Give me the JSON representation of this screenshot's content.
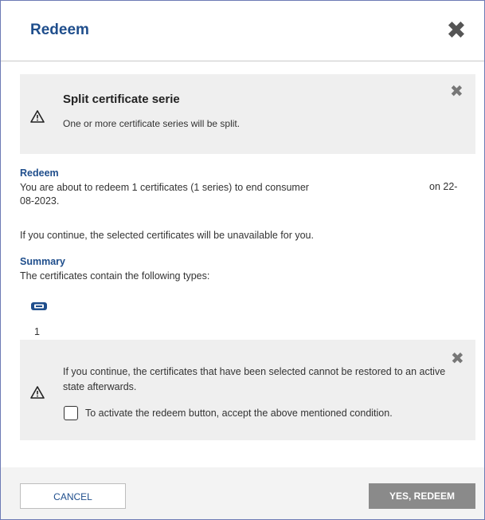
{
  "dialog": {
    "title": "Redeem"
  },
  "split_notice": {
    "title": "Split certificate serie",
    "text": "One or more certificate series will be split."
  },
  "redeem_section": {
    "heading": "Redeem",
    "line1": "You are about to redeem 1 certificates (1 series) to end consumer",
    "date_part1": "on 22-",
    "date_part2": "08-2023.",
    "unavailable_text": "If you continue, the selected certificates will be unavailable for you."
  },
  "summary_section": {
    "heading": "Summary",
    "text": "The certificates contain the following types:",
    "type_icon": "certificate-type-icon",
    "type_count": "1"
  },
  "warning_notice": {
    "text": "If you continue, the certificates that have been selected cannot be restored to an active state afterwards.",
    "checkbox_label": "To activate the redeem button, accept the above mentioned condition.",
    "checkbox_checked": false
  },
  "footer": {
    "cancel_label": "CANCEL",
    "redeem_label": "YES, REDEEM"
  },
  "colors": {
    "accent": "#1f4e8c",
    "panel_bg": "#efefef",
    "disabled_button": "#8a8a8a"
  }
}
